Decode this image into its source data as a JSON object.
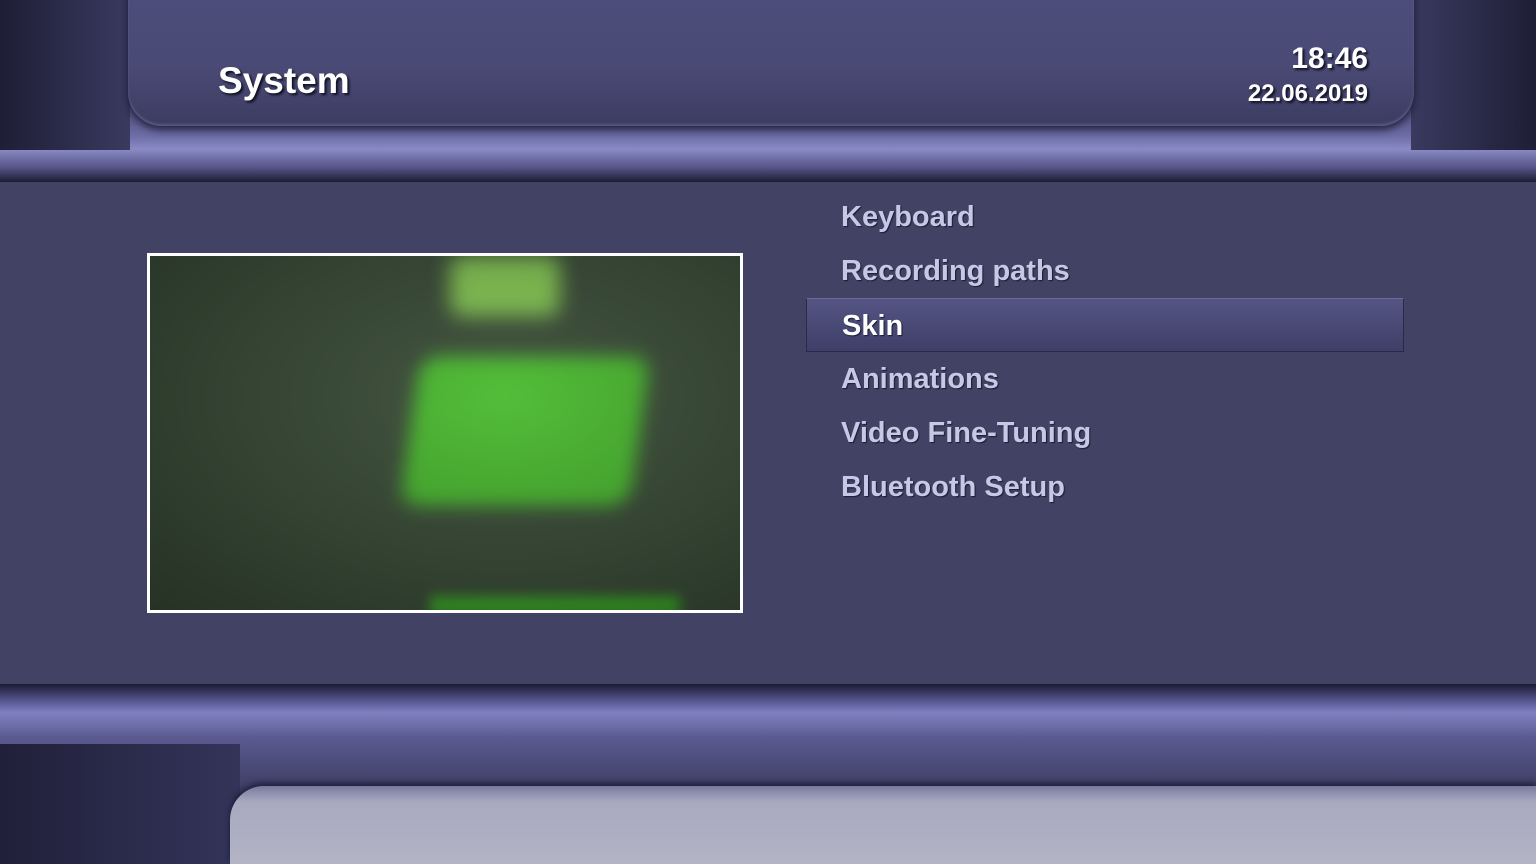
{
  "header": {
    "title": "System",
    "time": "18:46",
    "date": "22.06.2019"
  },
  "menu": {
    "items": [
      {
        "label": "Keyboard"
      },
      {
        "label": "Recording paths"
      },
      {
        "label": "Skin",
        "selected": true
      },
      {
        "label": "Animations"
      },
      {
        "label": "Video Fine-Tuning"
      },
      {
        "label": "Bluetooth Setup"
      }
    ]
  },
  "colors": {
    "background": "#424265",
    "selection": "#4a4a76",
    "menu_text": "#c8c8e6",
    "selected_text": "#ffffff"
  }
}
